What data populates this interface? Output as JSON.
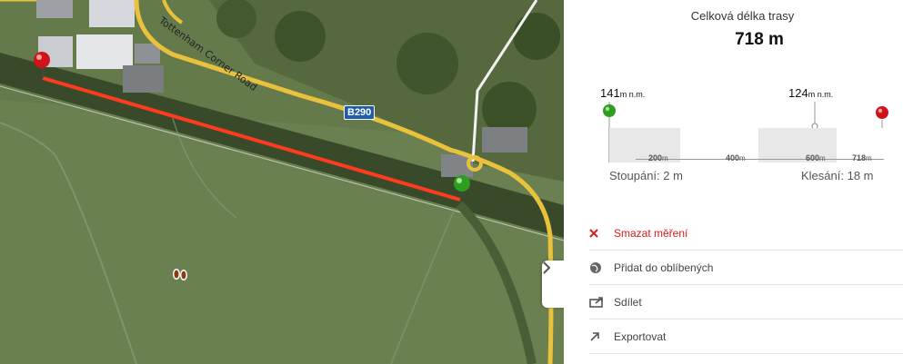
{
  "map": {
    "road_name": "Tottenham Corner Road",
    "road_badge": "B290",
    "icons": [
      "start-pin-icon",
      "end-pin-icon",
      "footprints-icon"
    ],
    "colors": {
      "route": "#ff3b1f",
      "road": "#e9c13c"
    }
  },
  "panel": {
    "total_label": "Celková délka trasy",
    "total_value": "718 m",
    "elev_start": "141",
    "elev_end": "124",
    "elev_unit": "m n.m.",
    "ticks": [
      {
        "value": "200",
        "unit": "m"
      },
      {
        "value": "400",
        "unit": "m"
      },
      {
        "value": "600",
        "unit": "m"
      },
      {
        "value": "718",
        "unit": "m"
      }
    ],
    "ascent": "Stoupání: 2 m",
    "descent": "Klesání: 18 m"
  },
  "menu": {
    "delete": "Smazat měření",
    "favorite": "Přidat do oblíbených",
    "share": "Sdílet",
    "export": "Exportovat"
  }
}
